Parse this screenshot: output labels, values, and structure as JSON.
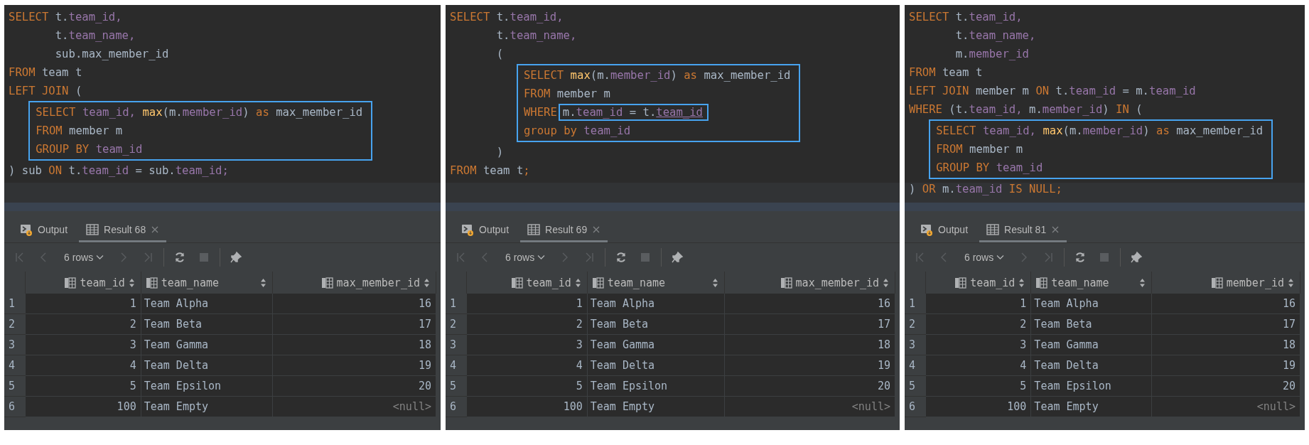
{
  "panels": [
    {
      "code": [
        {
          "kind": "plain",
          "lines": [
            {
              "tokens": [
                {
                  "text": "SELECT",
                  "kind": "keyword"
                },
                {
                  "text": " t.",
                  "kind": "plain"
                },
                {
                  "text": "team_id,",
                  "kind": "field"
                }
              ]
            },
            {
              "tokens": [
                {
                  "text": "       t.",
                  "kind": "plain"
                },
                {
                  "text": "team_name,",
                  "kind": "field"
                }
              ]
            },
            {
              "tokens": [
                {
                  "text": "       sub.max_member_id",
                  "kind": "plain"
                }
              ]
            },
            {
              "tokens": [
                {
                  "text": "FROM",
                  "kind": "keyword"
                },
                {
                  "text": " team t",
                  "kind": "plain"
                }
              ]
            },
            {
              "tokens": [
                {
                  "text": "LEFT JOIN",
                  "kind": "keyword"
                },
                {
                  "text": " (",
                  "kind": "plain"
                }
              ]
            }
          ]
        },
        {
          "kind": "highlight",
          "lines": [
            {
              "tokens": [
                {
                  "text": "SELECT",
                  "kind": "keyword"
                },
                {
                  "text": " team_id,",
                  "kind": "field"
                },
                {
                  "text": " max",
                  "kind": "function"
                },
                {
                  "text": "(m.",
                  "kind": "plain"
                },
                {
                  "text": "member_id",
                  "kind": "field"
                },
                {
                  "text": ") ",
                  "kind": "plain"
                },
                {
                  "text": "as",
                  "kind": "keyword"
                },
                {
                  "text": " max_member_id",
                  "kind": "plain"
                }
              ]
            },
            {
              "tokens": [
                {
                  "text": "FROM",
                  "kind": "keyword"
                },
                {
                  "text": " member m",
                  "kind": "plain"
                }
              ]
            },
            {
              "tokens": [
                {
                  "text": "GROUP BY",
                  "kind": "keyword"
                },
                {
                  "text": " team_id",
                  "kind": "field"
                }
              ]
            }
          ]
        },
        {
          "kind": "plain",
          "lines": [
            {
              "tokens": [
                {
                  "text": ") sub ",
                  "kind": "plain"
                },
                {
                  "text": "ON",
                  "kind": "keyword"
                },
                {
                  "text": " t.",
                  "kind": "plain"
                },
                {
                  "text": "team_id",
                  "kind": "field"
                },
                {
                  "text": " = sub.",
                  "kind": "plain"
                },
                {
                  "text": "team_id;",
                  "kind": "field"
                }
              ]
            }
          ]
        }
      ],
      "results": {
        "tabs": [
          {
            "label": "Output",
            "kind": "output",
            "selected": false
          },
          {
            "label": "Result 68",
            "kind": "result",
            "selected": true
          }
        ],
        "toolbar": [
          {
            "kind": "first",
            "disabled": true
          },
          {
            "kind": "previous",
            "disabled": true
          },
          {
            "kind": "rows",
            "label": "6 rows"
          },
          {
            "kind": "next",
            "disabled": true
          },
          {
            "kind": "last",
            "disabled": true
          },
          {
            "kind": "separator"
          },
          {
            "kind": "refresh",
            "disabled": false
          },
          {
            "kind": "stop",
            "disabled": true
          },
          {
            "kind": "separator"
          },
          {
            "kind": "pin",
            "disabled": false
          }
        ],
        "columns": [
          {
            "name": "team_id",
            "kind": "number"
          },
          {
            "name": "team_name",
            "kind": "text"
          },
          {
            "name": "max_member_id",
            "kind": "number"
          }
        ],
        "rows": [
          {
            "number": "1",
            "cells": [
              "1",
              "Team Alpha",
              "16"
            ]
          },
          {
            "number": "2",
            "cells": [
              "2",
              "Team Beta",
              "17"
            ]
          },
          {
            "number": "3",
            "cells": [
              "3",
              "Team Gamma",
              "18"
            ]
          },
          {
            "number": "4",
            "cells": [
              "4",
              "Team Delta",
              "19"
            ]
          },
          {
            "number": "5",
            "cells": [
              "5",
              "Team Epsilon",
              "20"
            ]
          },
          {
            "number": "6",
            "cells": [
              "100",
              "Team Empty",
              {
                "text": "<null>",
                "kind": "null"
              }
            ]
          }
        ]
      }
    },
    {
      "code": [
        {
          "kind": "plain",
          "lines": [
            {
              "tokens": [
                {
                  "text": "SELECT",
                  "kind": "keyword"
                },
                {
                  "text": " t.",
                  "kind": "plain"
                },
                {
                  "text": "team_id,",
                  "kind": "field"
                }
              ]
            },
            {
              "tokens": [
                {
                  "text": "       t.",
                  "kind": "plain"
                },
                {
                  "text": "team_name,",
                  "kind": "field"
                }
              ]
            },
            {
              "tokens": [
                {
                  "text": "       (",
                  "kind": "plain"
                }
              ]
            }
          ]
        },
        {
          "kind": "highlight",
          "lines": [
            {
              "tokens": [
                {
                  "text": "SELECT",
                  "kind": "keyword"
                },
                {
                  "text": " max",
                  "kind": "function"
                },
                {
                  "text": "(m.",
                  "kind": "plain"
                },
                {
                  "text": "member_id",
                  "kind": "field"
                },
                {
                  "text": ") ",
                  "kind": "plain"
                },
                {
                  "text": "as",
                  "kind": "keyword"
                },
                {
                  "text": " max_member_id",
                  "kind": "plain"
                }
              ]
            },
            {
              "tokens": [
                {
                  "text": "FROM",
                  "kind": "keyword"
                },
                {
                  "text": " member m",
                  "kind": "plain"
                }
              ]
            },
            {
              "tokens": [
                {
                  "text": "WHERE",
                  "kind": "keyword"
                },
                {
                  "kind": "box",
                  "tokens": [
                    {
                      "text": "m.",
                      "kind": "plain"
                    },
                    {
                      "text": "team_id",
                      "kind": "field"
                    },
                    {
                      "text": " = t.",
                      "kind": "plain"
                    },
                    {
                      "text": "team_id",
                      "kind": "field-link"
                    }
                  ]
                }
              ]
            },
            {
              "tokens": [
                {
                  "text": "group by",
                  "kind": "keyword"
                },
                {
                  "text": " team_id",
                  "kind": "field"
                }
              ]
            }
          ]
        },
        {
          "kind": "plain",
          "lines": [
            {
              "tokens": [
                {
                  "text": "       )",
                  "kind": "plain"
                }
              ]
            },
            {
              "tokens": [
                {
                  "text": "FROM",
                  "kind": "keyword"
                },
                {
                  "text": " team t",
                  "kind": "plain"
                },
                {
                  "text": ";",
                  "kind": "keyword"
                }
              ]
            }
          ]
        }
      ],
      "results": {
        "tabs": [
          {
            "label": "Output",
            "kind": "output",
            "selected": false
          },
          {
            "label": "Result 69",
            "kind": "result",
            "selected": true
          }
        ],
        "toolbar": [
          {
            "kind": "first",
            "disabled": true
          },
          {
            "kind": "previous",
            "disabled": true
          },
          {
            "kind": "rows",
            "label": "6 rows"
          },
          {
            "kind": "next",
            "disabled": true
          },
          {
            "kind": "last",
            "disabled": true
          },
          {
            "kind": "separator"
          },
          {
            "kind": "refresh",
            "disabled": false
          },
          {
            "kind": "stop",
            "disabled": true
          },
          {
            "kind": "separator"
          },
          {
            "kind": "pin",
            "disabled": false
          }
        ],
        "columns": [
          {
            "name": "team_id",
            "kind": "number"
          },
          {
            "name": "team_name",
            "kind": "text"
          },
          {
            "name": "max_member_id",
            "kind": "number"
          }
        ],
        "rows": [
          {
            "number": "1",
            "cells": [
              "1",
              "Team Alpha",
              "16"
            ]
          },
          {
            "number": "2",
            "cells": [
              "2",
              "Team Beta",
              "17"
            ]
          },
          {
            "number": "3",
            "cells": [
              "3",
              "Team Gamma",
              "18"
            ]
          },
          {
            "number": "4",
            "cells": [
              "4",
              "Team Delta",
              "19"
            ]
          },
          {
            "number": "5",
            "cells": [
              "5",
              "Team Epsilon",
              "20"
            ]
          },
          {
            "number": "6",
            "cells": [
              "100",
              "Team Empty",
              {
                "text": "<null>",
                "kind": "null"
              }
            ]
          }
        ]
      }
    },
    {
      "code": [
        {
          "kind": "plain",
          "lines": [
            {
              "tokens": [
                {
                  "text": "SELECT",
                  "kind": "keyword"
                },
                {
                  "text": " t.",
                  "kind": "plain"
                },
                {
                  "text": "team_id,",
                  "kind": "field"
                }
              ]
            },
            {
              "tokens": [
                {
                  "text": "       t.",
                  "kind": "plain"
                },
                {
                  "text": "team_name,",
                  "kind": "field"
                }
              ]
            },
            {
              "tokens": [
                {
                  "text": "       m.",
                  "kind": "plain"
                },
                {
                  "text": "member_id",
                  "kind": "field"
                }
              ]
            },
            {
              "tokens": [
                {
                  "text": "FROM",
                  "kind": "keyword"
                },
                {
                  "text": " team t",
                  "kind": "plain"
                }
              ]
            },
            {
              "tokens": [
                {
                  "text": "LEFT JOIN",
                  "kind": "keyword"
                },
                {
                  "text": " member m ",
                  "kind": "plain"
                },
                {
                  "text": "ON",
                  "kind": "keyword"
                },
                {
                  "text": " t.",
                  "kind": "plain"
                },
                {
                  "text": "team_id",
                  "kind": "field"
                },
                {
                  "text": " = m.",
                  "kind": "plain"
                },
                {
                  "text": "team_id",
                  "kind": "field"
                }
              ]
            },
            {
              "tokens": [
                {
                  "text": "WHERE",
                  "kind": "keyword"
                },
                {
                  "text": " (t.",
                  "kind": "plain"
                },
                {
                  "text": "team_id,",
                  "kind": "field"
                },
                {
                  "text": " m.",
                  "kind": "plain"
                },
                {
                  "text": "member_id",
                  "kind": "field"
                },
                {
                  "text": ") ",
                  "kind": "plain"
                },
                {
                  "text": "IN",
                  "kind": "keyword"
                },
                {
                  "text": " (",
                  "kind": "plain"
                }
              ]
            }
          ]
        },
        {
          "kind": "highlight",
          "lines": [
            {
              "tokens": [
                {
                  "text": "SELECT",
                  "kind": "keyword"
                },
                {
                  "text": " team_id,",
                  "kind": "field"
                },
                {
                  "text": " max",
                  "kind": "function"
                },
                {
                  "text": "(m.",
                  "kind": "plain"
                },
                {
                  "text": "member_id",
                  "kind": "field"
                },
                {
                  "text": ") ",
                  "kind": "plain"
                },
                {
                  "text": "as",
                  "kind": "keyword"
                },
                {
                  "text": " max_member_id",
                  "kind": "plain"
                }
              ]
            },
            {
              "tokens": [
                {
                  "text": "FROM",
                  "kind": "keyword"
                },
                {
                  "text": " member m",
                  "kind": "plain"
                }
              ]
            },
            {
              "tokens": [
                {
                  "text": "GROUP BY",
                  "kind": "keyword"
                },
                {
                  "text": " team_id",
                  "kind": "field"
                }
              ]
            }
          ]
        },
        {
          "kind": "plain",
          "lines": [
            {
              "tokens": [
                {
                  "text": ") ",
                  "kind": "plain"
                },
                {
                  "text": "OR",
                  "kind": "keyword"
                },
                {
                  "text": " m.",
                  "kind": "plain"
                },
                {
                  "text": "team_id",
                  "kind": "field"
                },
                {
                  "text": " IS NULL;",
                  "kind": "keyword"
                }
              ]
            }
          ]
        }
      ],
      "results": {
        "tabs": [
          {
            "label": "Output",
            "kind": "output",
            "selected": false
          },
          {
            "label": "Result 81",
            "kind": "result",
            "selected": true
          }
        ],
        "toolbar": [
          {
            "kind": "first",
            "disabled": true
          },
          {
            "kind": "previous",
            "disabled": true
          },
          {
            "kind": "rows",
            "label": "6 rows"
          },
          {
            "kind": "next",
            "disabled": true
          },
          {
            "kind": "last",
            "disabled": true
          },
          {
            "kind": "separator"
          },
          {
            "kind": "refresh",
            "disabled": false
          },
          {
            "kind": "stop",
            "disabled": true
          },
          {
            "kind": "separator"
          },
          {
            "kind": "pin",
            "disabled": false
          }
        ],
        "columns": [
          {
            "name": "team_id",
            "kind": "number"
          },
          {
            "name": "team_name",
            "kind": "text"
          },
          {
            "name": "member_id",
            "kind": "number"
          }
        ],
        "rows": [
          {
            "number": "1",
            "cells": [
              "1",
              "Team Alpha",
              "16"
            ]
          },
          {
            "number": "2",
            "cells": [
              "2",
              "Team Beta",
              "17"
            ]
          },
          {
            "number": "3",
            "cells": [
              "3",
              "Team Gamma",
              "18"
            ]
          },
          {
            "number": "4",
            "cells": [
              "4",
              "Team Delta",
              "19"
            ]
          },
          {
            "number": "5",
            "cells": [
              "5",
              "Team Epsilon",
              "20"
            ]
          },
          {
            "number": "6",
            "cells": [
              "100",
              "Team Empty",
              {
                "text": "<null>",
                "kind": "null"
              }
            ]
          }
        ]
      }
    }
  ]
}
